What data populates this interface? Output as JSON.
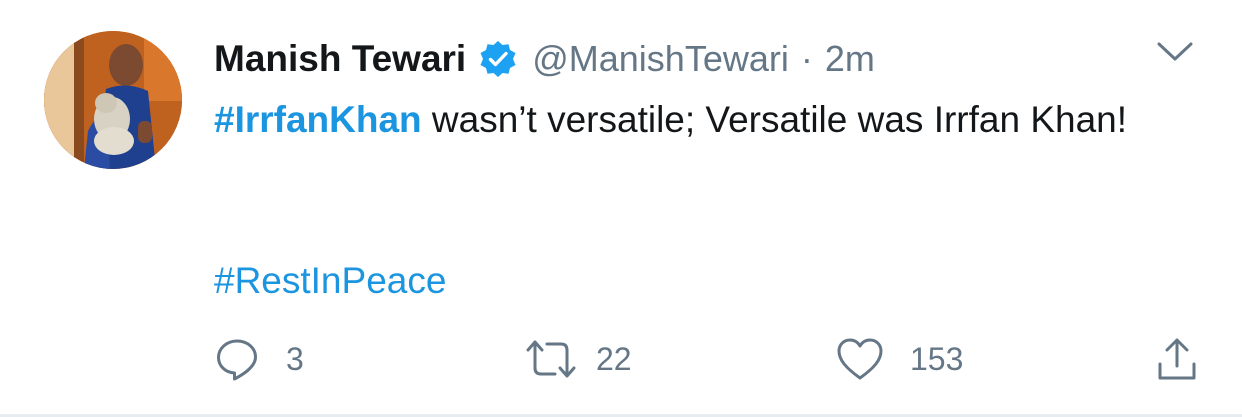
{
  "tweet": {
    "display_name": "Manish Tewari",
    "handle": "@ManishTewari",
    "separator": "·",
    "time": "2m",
    "text_hashtag": "#IrrfanKhan",
    "text_rest": " wasn’t versatile; Versatile was Irrfan Khan!",
    "hashtag_2": "#RestInPeace"
  },
  "actions": {
    "reply_count": "3",
    "retweet_count": "22",
    "like_count": "153"
  },
  "colors": {
    "link": "#1b95e0",
    "text": "#14171a",
    "muted": "#657786",
    "verified": "#1da1f2"
  },
  "icons": {
    "verified": "verified-badge-icon",
    "menu": "chevron-down-icon",
    "reply": "reply-icon",
    "retweet": "retweet-icon",
    "like": "heart-icon",
    "share": "share-icon"
  }
}
